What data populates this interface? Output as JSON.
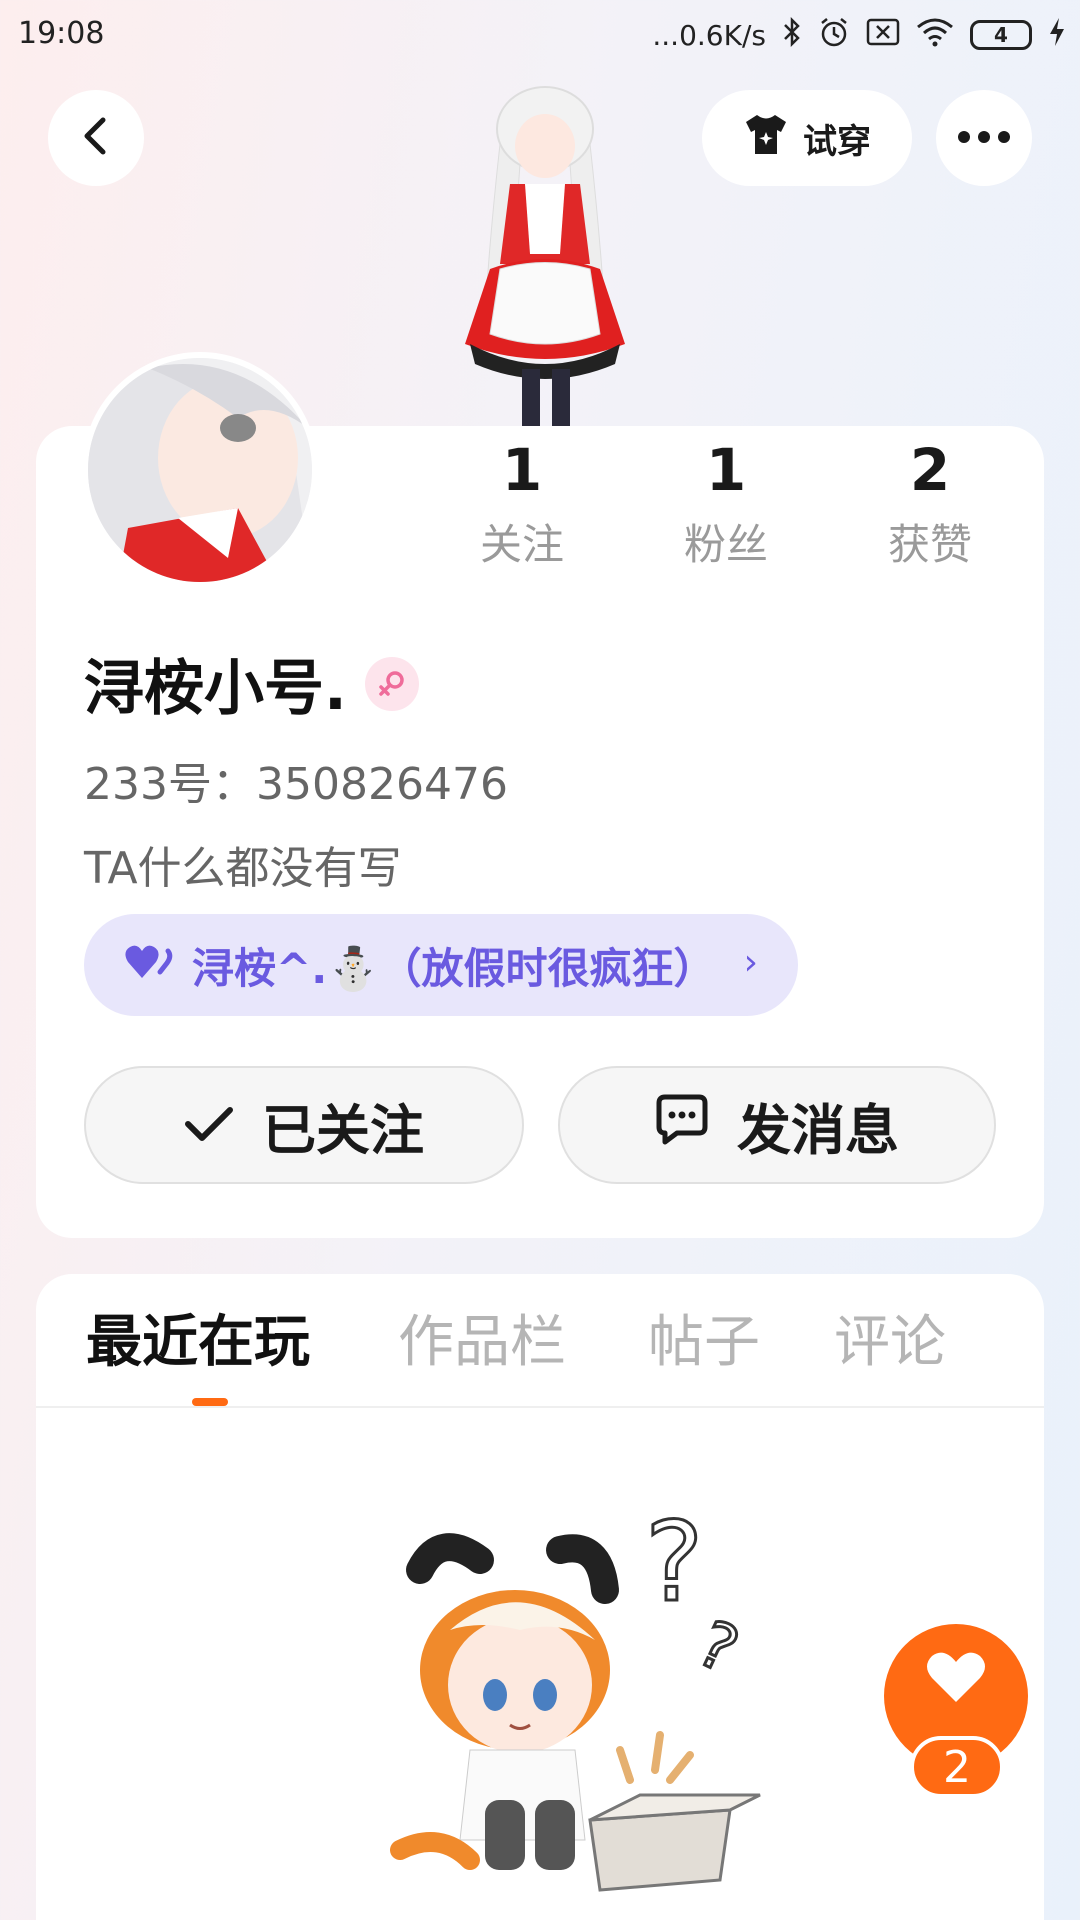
{
  "status_bar": {
    "time": "19:08",
    "network_speed": "...0.6K/s",
    "battery": "4"
  },
  "header": {
    "try_on_label": "试穿"
  },
  "profile": {
    "stats": [
      {
        "value": "1",
        "label": "关注"
      },
      {
        "value": "1",
        "label": "粉丝"
      },
      {
        "value": "2",
        "label": "获赞"
      }
    ],
    "username": "浔桉小号.",
    "id_label": "233号：",
    "id_value": "350826476",
    "bio": "TA什么都没有写",
    "relation": "浔桉^.⛄（放假时很疯狂）",
    "follow_label": "已关注",
    "message_label": "发消息"
  },
  "tabs": [
    {
      "label": "最近在玩",
      "active": true
    },
    {
      "label": "作品栏",
      "active": false
    },
    {
      "label": "帖子",
      "active": false
    },
    {
      "label": "评论",
      "active": false
    }
  ],
  "like": {
    "count": "2"
  },
  "colors": {
    "accent": "#ff6a13",
    "relation_bg": "#e8e6fb",
    "relation_text": "#6a5ae0"
  }
}
